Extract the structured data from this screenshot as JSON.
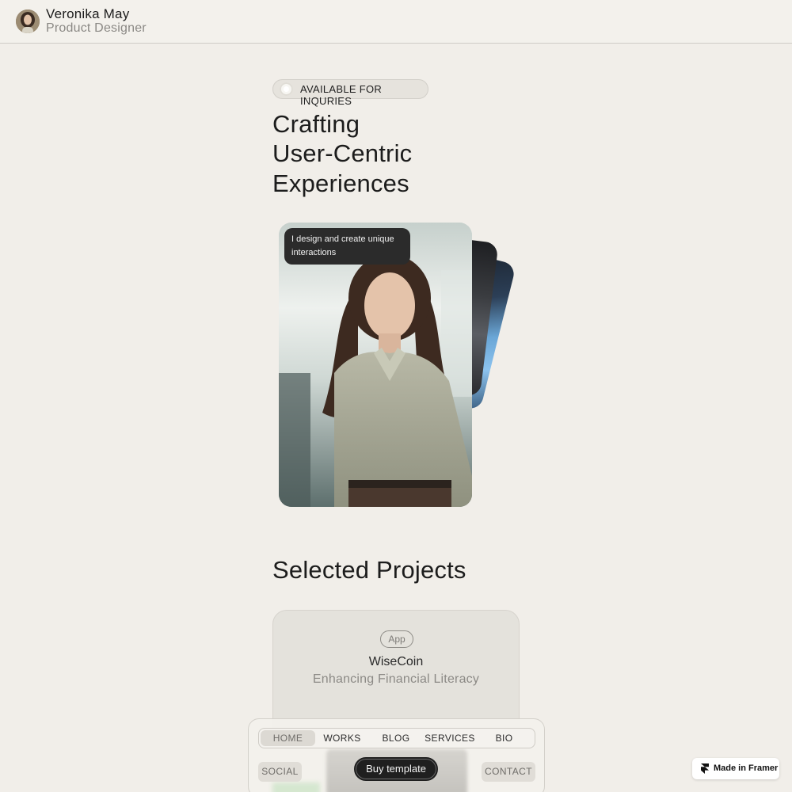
{
  "header": {
    "name": "Veronika May",
    "role": "Product Designer"
  },
  "availability": {
    "label": "AVAILABLE FOR INQURIES"
  },
  "hero": {
    "lines": [
      "Crafting",
      "User-Centric",
      "Experiences"
    ]
  },
  "card": {
    "tooltip": "I design and create unique interactions"
  },
  "projects": {
    "title": "Selected Projects",
    "items": [
      {
        "tag": "App",
        "title": "WiseCoin",
        "subtitle": "Enhancing Financial Literacy"
      }
    ]
  },
  "nav": {
    "items": [
      {
        "label": "HOME",
        "active": true
      },
      {
        "label": "WORKS",
        "active": false
      },
      {
        "label": "BLOG",
        "active": false
      },
      {
        "label": "SERVICES",
        "active": false
      },
      {
        "label": "BIO",
        "active": false
      }
    ],
    "social": "SOCIAL",
    "contact": "CONTACT",
    "buy": "Buy template"
  },
  "badge": {
    "label": "Made in Framer"
  },
  "colors": {
    "background": "#f1eee9",
    "text": "#1c1c1c",
    "muted": "#8b8985",
    "dark_button": "#1f1f1f"
  },
  "icons": {
    "availability": "status-dot-icon",
    "framer": "framer-logo-icon"
  }
}
